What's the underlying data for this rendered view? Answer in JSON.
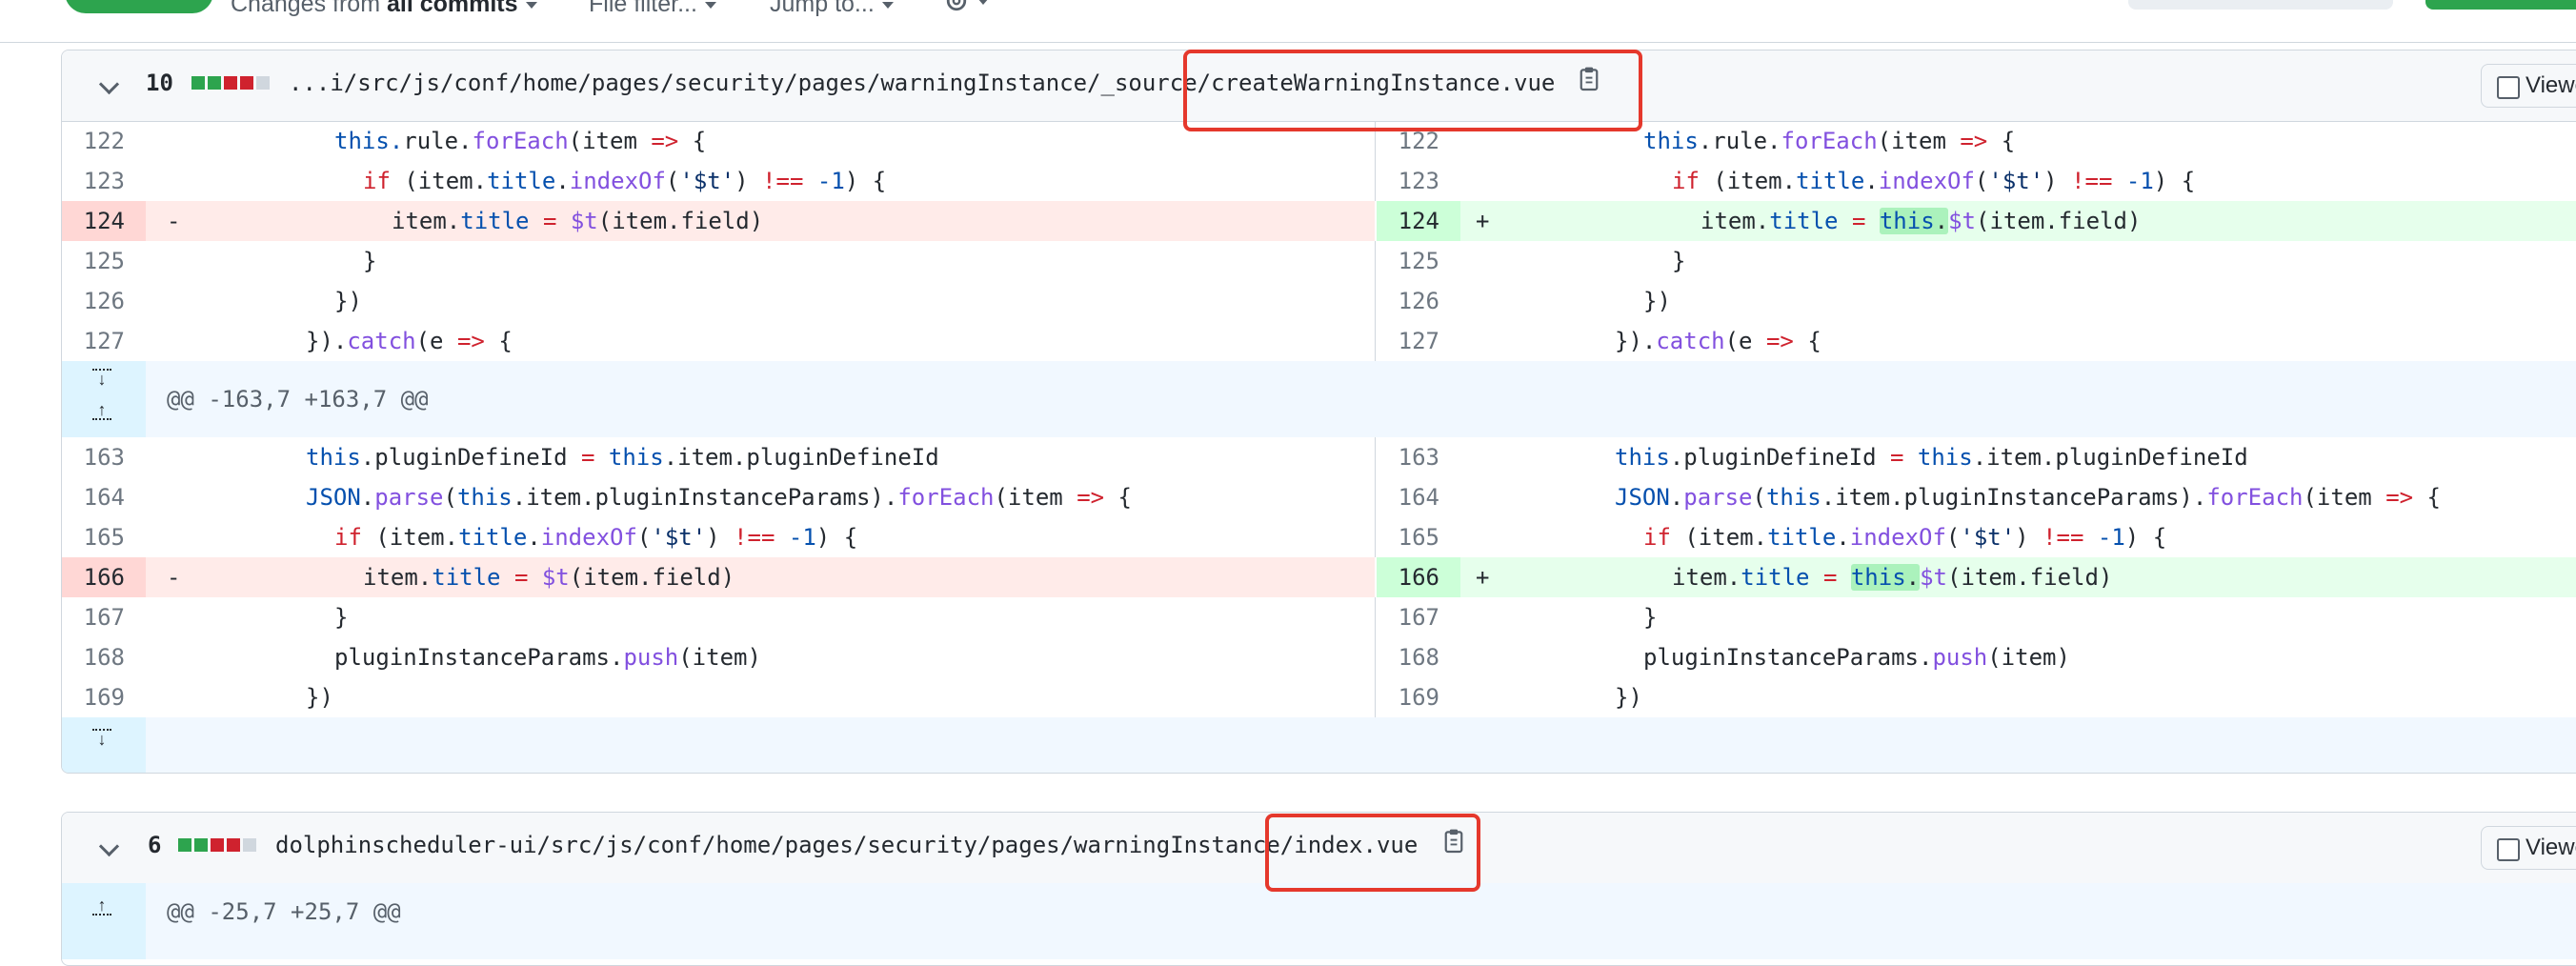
{
  "toolbar": {
    "changes_prefix": "Changes from ",
    "changes_value": "all commits",
    "file_filter": "File filter...",
    "jump_to": "Jump to..."
  },
  "files": [
    {
      "count": "10",
      "path_prefix": "...i/src/js/conf/home/pages/security/pages/warningInstance/_source/",
      "file_name": "createWarningInstance.vue",
      "viewed_label": "Viewed",
      "hunk1_numbers": [
        "122",
        "123",
        "124",
        "125",
        "126",
        "127"
      ],
      "hunk2_header": "@@ -163,7 +163,7 @@",
      "hunk2_numbers": [
        "163",
        "164",
        "165",
        "166",
        "167",
        "168",
        "169"
      ]
    },
    {
      "count": "6",
      "path_prefix": "dolphinscheduler-ui/src/js/conf/home/pages/security/pages/warningInstance/",
      "file_name": "index.vue",
      "viewed_label": "Viewed",
      "hunk_header": "@@ -25,7 +25,7 @@"
    }
  ],
  "code": {
    "l122": "this.rule.forEach(item => {",
    "l123": "if (item.title.indexOf('$t') !== -1) {",
    "l124_old": "item.title = $t(item.field)",
    "l124_new_a": "item.title = ",
    "l124_new_hl": "this.",
    "l124_new_b": "$t(item.field)",
    "l125": "}",
    "l126": "})",
    "l127": "}).catch(e => {",
    "l163": "this.pluginDefineId = this.item.pluginDefineId",
    "l164": "JSON.parse(this.item.pluginInstanceParams).forEach(item => {",
    "l165": "if (item.title.indexOf('$t') !== -1) {",
    "l166_old": "item.title = $t(item.field)",
    "l166_new_a": "item.title = ",
    "l166_new_hl": "this.",
    "l166_new_b": "$t(item.field)",
    "l167": "}",
    "l168": "pluginInstanceParams.push(item)",
    "l169": "})",
    "minus": "-",
    "plus": "+"
  },
  "colors": {
    "accent_green": "#2da44e",
    "deletion_bg": "#ffebe9",
    "addition_bg": "#e6ffec",
    "annotation_red": "#e5382c"
  }
}
